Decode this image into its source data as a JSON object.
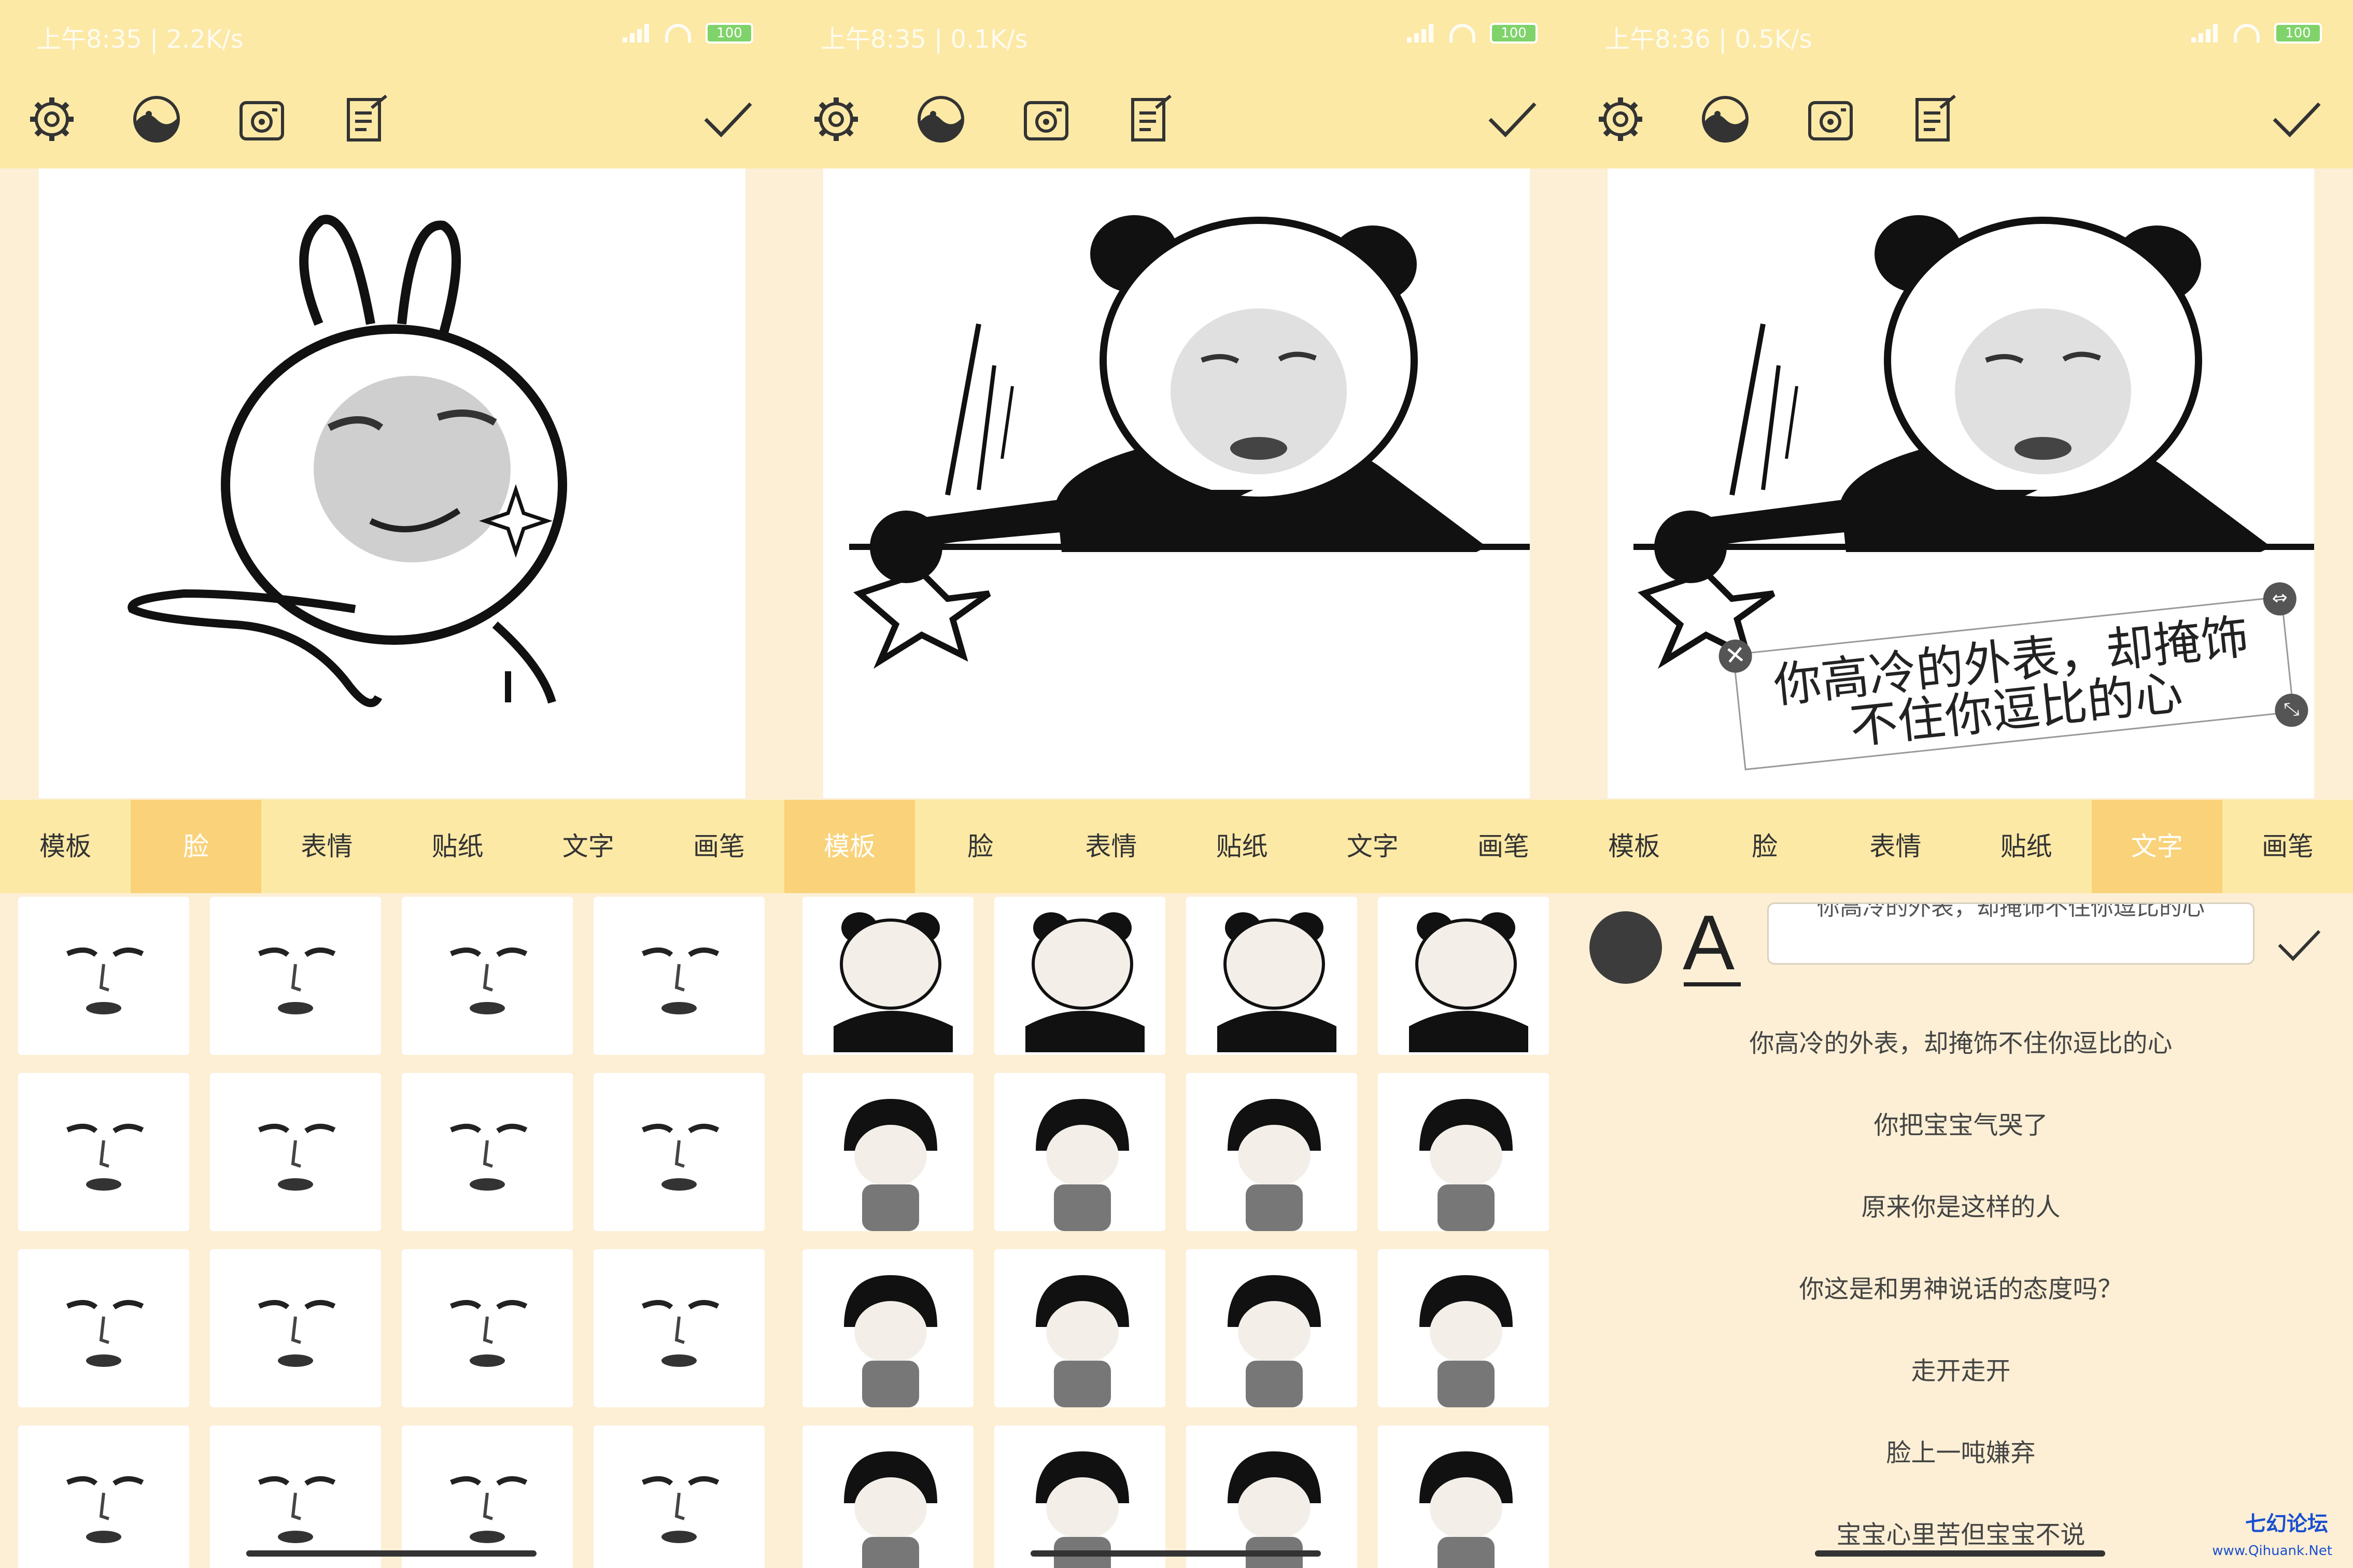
{
  "panels": [
    {
      "status": {
        "time": "上午8:35",
        "speed": "2.2K/s",
        "battery": "100"
      },
      "active_tab": 1,
      "grid_cols": 4,
      "grid_rows": 4
    },
    {
      "status": {
        "time": "上午8:35",
        "speed": "0.1K/s",
        "battery": "100"
      },
      "active_tab": 0,
      "grid_cols": 4,
      "grid_rows": 4
    },
    {
      "status": {
        "time": "上午8:36",
        "speed": "0.5K/s",
        "battery": "100"
      },
      "active_tab": 4
    }
  ],
  "toolbar": {
    "icons": [
      "gear-icon",
      "yin-yang-icon",
      "camera-icon",
      "edit-note-icon"
    ],
    "confirm_icon": "check-icon"
  },
  "tabs": [
    "模板",
    "脸",
    "表情",
    "贴纸",
    "文字",
    "画笔"
  ],
  "caption": {
    "line1": "你高冷的外表，却掩饰",
    "line2": "不住你逗比的心"
  },
  "text_panel": {
    "input_value": "你高冷的外表，却掩饰不住你逗比的心",
    "font_button": "A",
    "presets": [
      "你高冷的外表，却掩饰不住你逗比的心",
      "你把宝宝气哭了",
      "原来你是这样的人",
      "你这是和男神说话的态度吗？",
      "走开走开",
      "脸上一吨嫌弃",
      "宝宝心里苦但宝宝不说"
    ]
  },
  "watermark": {
    "name": "七幻论坛",
    "url": "www.Qihuank.Net"
  },
  "colors": {
    "bar": "#fce9a6",
    "active_tab": "#f9d27a",
    "background": "#fcefd5"
  }
}
